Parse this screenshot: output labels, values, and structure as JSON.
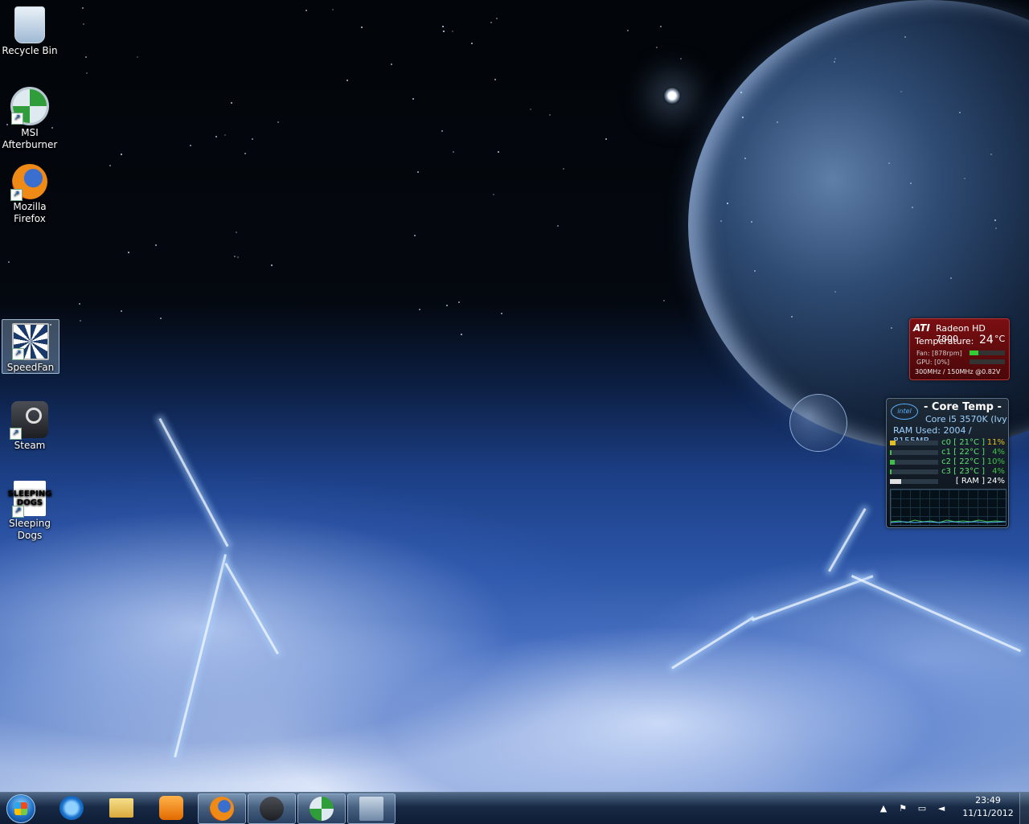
{
  "desktop_icons": [
    {
      "label": "Recycle Bin",
      "icon": "recycle-bin-icon"
    },
    {
      "label": "MSI Afterburner",
      "icon": "msi-afterburner-icon"
    },
    {
      "label": "Mozilla Firefox",
      "icon": "firefox-icon"
    },
    {
      "label": "SpeedFan",
      "icon": "speedfan-icon",
      "selected": true
    },
    {
      "label": "Steam",
      "icon": "steam-icon"
    },
    {
      "label": "Sleeping Dogs",
      "icon": "sleeping-dogs-icon",
      "logo_text": "SLEEPING DOGS"
    }
  ],
  "ati_gadget": {
    "brand": "ATI",
    "model": "Radeon HD 7800",
    "temperature_label": "Temperature:",
    "temperature_value": "24",
    "temperature_unit": "°C",
    "fan": "Fan: [878rpm]",
    "fan_level": 0.25,
    "gpu": "GPU: [0%]",
    "gpu_level": 0.0,
    "clocks": "300MHz / 150MHz @0.82V"
  },
  "core_temp_gadget": {
    "logo": "intel",
    "title": "- Core Temp -",
    "cpu": "Core i5 3570K (Ivy",
    "ram_used": "RAM Used: 2004 / 8155MB",
    "cores": [
      {
        "label": "c0 [ 21°C ]",
        "load": "11%",
        "level": 0.11,
        "color": "#e0c020"
      },
      {
        "label": "c1 [ 22°C ]",
        "load": "4%",
        "level": 0.04,
        "color": "#3fc04a"
      },
      {
        "label": "c2 [ 22°C ]",
        "load": "10%",
        "level": 0.1,
        "color": "#3fc04a"
      },
      {
        "label": "c3 [ 23°C ]",
        "load": "4%",
        "level": 0.04,
        "color": "#3fc04a"
      }
    ],
    "ram": {
      "label": "[ RAM ]",
      "load": "24%",
      "level": 0.24,
      "color": "#e0e0e0"
    }
  },
  "taskbar": {
    "start_icon": "windows-start-orb",
    "pinned": [
      {
        "name": "internet-explorer",
        "icon": "internet-explorer-icon",
        "open": false
      },
      {
        "name": "windows-explorer",
        "icon": "folder-icon",
        "open": false
      },
      {
        "name": "windows-media-player",
        "icon": "media-player-icon",
        "open": false
      },
      {
        "name": "firefox",
        "icon": "firefox-icon",
        "open": true
      },
      {
        "name": "steam",
        "icon": "steam-icon",
        "open": true
      },
      {
        "name": "msi-afterburner",
        "icon": "msi-afterburner-icon",
        "open": true
      },
      {
        "name": "network-app",
        "icon": "network-icon",
        "open": true
      }
    ],
    "tray_icons": [
      "show-hidden-icons-arrow",
      "action-center-flag-icon",
      "network-icon",
      "volume-icon"
    ],
    "time": "23:49",
    "date": "11/11/2012"
  },
  "colors": {
    "ati_red": "#7a0f12",
    "coretemp_text": "#9fd3ff",
    "core_green": "#3fc04a",
    "core_yellow": "#e0c020"
  }
}
